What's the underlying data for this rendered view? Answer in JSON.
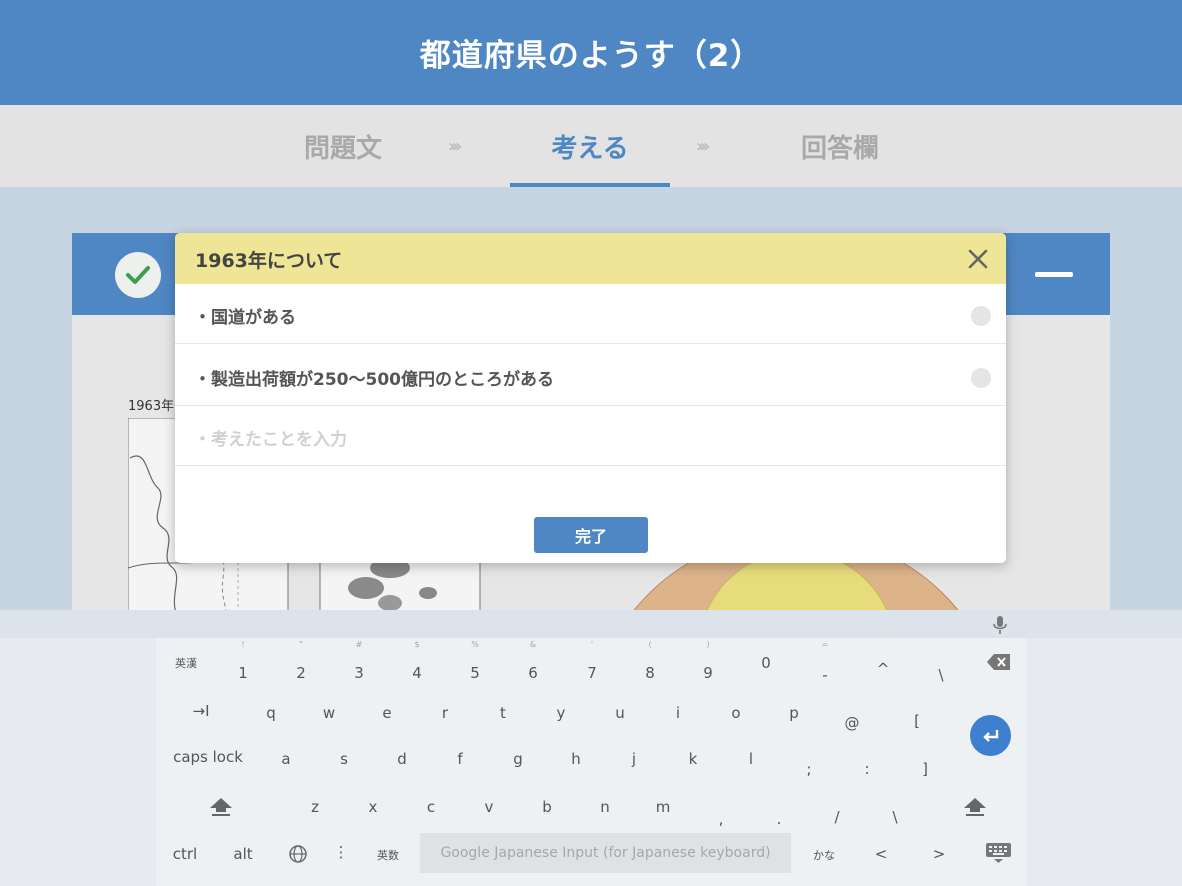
{
  "header": {
    "title": "都道府県のようす（2）"
  },
  "steps": {
    "items": [
      {
        "label": "問題文"
      },
      {
        "label": "考える"
      },
      {
        "label": "回答欄"
      }
    ],
    "separator": "›››",
    "active": "考える"
  },
  "panel": {
    "map_label": "1963年"
  },
  "modal": {
    "title": "1963年について",
    "items": [
      {
        "text": "・国道がある"
      },
      {
        "text": "・製造出荷額が250〜500億円のところがある"
      }
    ],
    "input_placeholder": "・考えたことを入力",
    "done_label": "完了"
  },
  "keyboard": {
    "row1_lead": "英漢",
    "row1": [
      "1",
      "2",
      "3",
      "4",
      "5",
      "6",
      "7",
      "8",
      "9",
      "0",
      "-",
      "^",
      "\\"
    ],
    "row1_shift": [
      "!",
      "\"",
      "#",
      "$",
      "%",
      "&",
      "'",
      "(",
      ")",
      "",
      "=",
      "",
      ""
    ],
    "row2_lead": "→I",
    "row2": [
      "q",
      "w",
      "e",
      "r",
      "t",
      "y",
      "u",
      "i",
      "o",
      "p",
      "@",
      "["
    ],
    "row3_lead": "caps lock",
    "row3": [
      "a",
      "s",
      "d",
      "f",
      "g",
      "h",
      "j",
      "k",
      "l",
      ";",
      ":",
      "]"
    ],
    "row4": [
      "z",
      "x",
      "c",
      "v",
      "b",
      "n",
      "m",
      ",",
      ".",
      "/",
      "\\"
    ],
    "bottom": {
      "ctrl": "ctrl",
      "alt": "alt",
      "more": "⋮",
      "eisu": "英数",
      "input_placeholder": "Google Japanese Input (for Japanese keyboard)",
      "kana": "かな",
      "left": "<",
      "right": ">"
    }
  },
  "colors": {
    "header_blue": "#4f87c4",
    "modal_header_yellow": "#eee596",
    "check_green": "#3aa04a",
    "enter_blue": "#3f7fd0"
  }
}
